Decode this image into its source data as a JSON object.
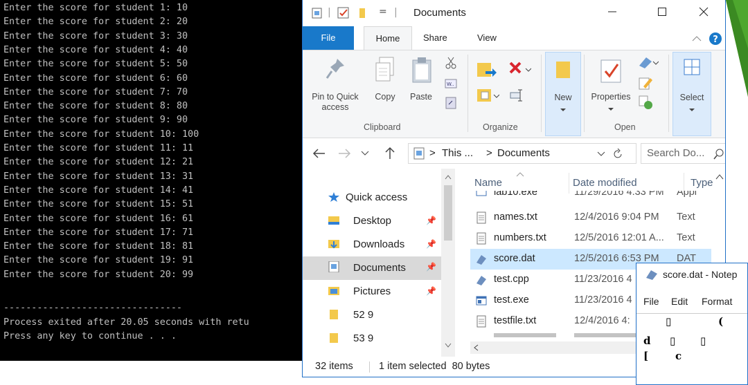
{
  "console": {
    "lines": [
      "Enter the score for student 1: 10",
      "Enter the score for student 2: 20",
      "Enter the score for student 3: 30",
      "Enter the score for student 4: 40",
      "Enter the score for student 5: 50",
      "Enter the score for student 6: 60",
      "Enter the score for student 7: 70",
      "Enter the score for student 8: 80",
      "Enter the score for student 9: 90",
      "Enter the score for student 10: 100",
      "Enter the score for student 11: 11",
      "Enter the score for student 12: 21",
      "Enter the score for student 13: 31",
      "Enter the score for student 14: 41",
      "Enter the score for student 15: 51",
      "Enter the score for student 16: 61",
      "Enter the score for student 17: 71",
      "Enter the score for student 18: 81",
      "Enter the score for student 19: 91",
      "Enter the score for student 20: 99",
      "",
      "--------------------------------",
      "Process exited after 20.05 seconds with retu",
      "Press any key to continue . . ."
    ]
  },
  "explorer": {
    "title": "Documents",
    "qat_separator": "|",
    "qat_dropdown": "=",
    "tabs": {
      "file": "File",
      "home": "Home",
      "share": "Share",
      "view": "View"
    },
    "ribbon": {
      "pin_label": "Pin to Quick access",
      "copy_label": "Copy",
      "paste_label": "Paste",
      "clipboard_group": "Clipboard",
      "organize_group": "Organize",
      "new_label": "New",
      "properties_label": "Properties",
      "open_group": "Open",
      "select_label": "Select"
    },
    "address": {
      "path_part1": "This ...",
      "sep": ">",
      "path_part2": "Documents",
      "search_placeholder": "Search Do..."
    },
    "nav": [
      {
        "label": "Quick access"
      },
      {
        "label": "Desktop"
      },
      {
        "label": "Downloads"
      },
      {
        "label": "Documents"
      },
      {
        "label": "Pictures"
      },
      {
        "label": "52 9"
      },
      {
        "label": "53 9"
      }
    ],
    "columns": {
      "name": "Name",
      "date": "Date modified",
      "type": "Type"
    },
    "files": [
      {
        "name": "lab10.exe",
        "date": "11/29/2016 4:33 PM",
        "type": "Appl"
      },
      {
        "name": "names.txt",
        "date": "12/4/2016 9:04 PM",
        "type": "Text"
      },
      {
        "name": "numbers.txt",
        "date": "12/5/2016 12:01 A...",
        "type": "Text"
      },
      {
        "name": "score.dat",
        "date": "12/5/2016 6:53 PM",
        "type": "DAT"
      },
      {
        "name": "test.cpp",
        "date": "11/23/2016 4",
        "type": ""
      },
      {
        "name": "test.exe",
        "date": "11/23/2016 4",
        "type": ""
      },
      {
        "name": "testfile.txt",
        "date": "12/4/2016 4:",
        "type": ""
      }
    ],
    "status": {
      "count": "32 items",
      "selection": "1 item selected  80 bytes"
    }
  },
  "notepad": {
    "title": "score.dat - Notep",
    "menu": {
      "file": "File",
      "edit": "Edit",
      "format": "Format"
    },
    "content_chars": [
      "▯",
      "(",
      "d",
      "▯",
      "▯",
      "[",
      "c"
    ]
  },
  "colors": {
    "console_bg": "#000000",
    "console_fg": "#c0c0c0",
    "file_tab": "#1979ca",
    "selection": "#cce8ff",
    "accent_green": "#4ea72e"
  }
}
